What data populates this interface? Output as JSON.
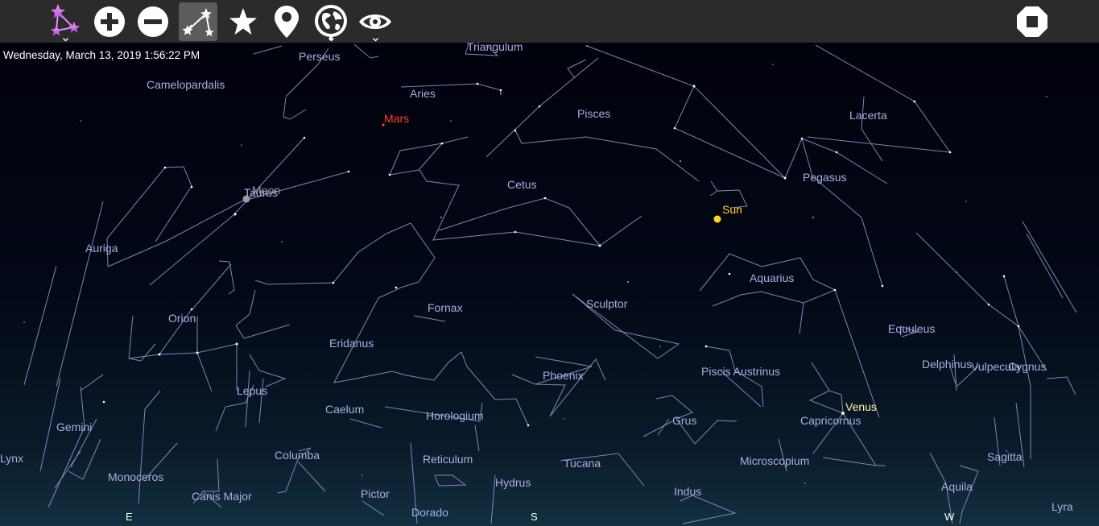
{
  "datetime": "Wednesday, March 13, 2019 1:56:22 PM",
  "toolbar": {
    "tools": [
      {
        "name": "constellations-menu",
        "icon": "constellation-icon",
        "has_dropdown": true
      },
      {
        "name": "zoom-in",
        "icon": "plus-circle-icon"
      },
      {
        "name": "zoom-out",
        "icon": "minus-circle-icon"
      },
      {
        "name": "constellation-lines",
        "icon": "constellation-lines-icon",
        "active": true
      },
      {
        "name": "favorites",
        "icon": "star-icon"
      },
      {
        "name": "location",
        "icon": "map-pin-icon"
      },
      {
        "name": "globe",
        "icon": "globe-icon",
        "has_dropdown": true
      },
      {
        "name": "view",
        "icon": "eye-icon",
        "has_dropdown": true
      },
      {
        "name": "stop",
        "icon": "stop-octagon-icon"
      }
    ]
  },
  "constellations": [
    "Perseus",
    "Triangulum",
    "Camelopardalis",
    "Aries",
    "Mars",
    "Pisces",
    "Lacerta",
    "Cetus",
    "Taurus",
    "Moon",
    "Sun",
    "Pegasus",
    "Auriga",
    "Aquarius",
    "Orion",
    "Fornax",
    "Sculptor",
    "Equuleus",
    "Eridanus",
    "Delphinus",
    "Vulpecula",
    "Cygnus",
    "Phoenix",
    "Piscis Austrinus",
    "Lepus",
    "Venus",
    "Caelum",
    "Horologium",
    "Grus",
    "Capricornus",
    "Gemini",
    "Lynx",
    "Columba",
    "Reticulum",
    "Tucana",
    "Microscopium",
    "Sagitta",
    "Monoceros",
    "Canis Major",
    "Hydrus",
    "Aquila",
    "Pictor",
    "Indus",
    "Dorado",
    "Lyra"
  ],
  "labels": {
    "perseus": "Perseus",
    "triangulum": "Triangulum",
    "camelopardalis": "Camelopardalis",
    "aries": "Aries",
    "pisces": "Pisces",
    "lacerta": "Lacerta",
    "cetus": "Cetus",
    "taurus": "Taurus",
    "pegasus": "Pegasus",
    "auriga": "Auriga",
    "aquarius": "Aquarius",
    "orion": "Orion",
    "fornax": "Fornax",
    "sculptor": "Sculptor",
    "equuleus": "Equuleus",
    "eridanus": "Eridanus",
    "delphinus": "Delphinus",
    "vulpecula": "Vulpecula",
    "cygnus": "Cygnus",
    "phoenix": "Phoenix",
    "piscis_austrinus": "Piscis Austrinus",
    "lepus": "Lepus",
    "caelum": "Caelum",
    "horologium": "Horologium",
    "grus": "Grus",
    "capricornus": "Capricornus",
    "gemini": "Gemini",
    "lynx": "Lynx",
    "columba": "Columba",
    "reticulum": "Reticulum",
    "tucana": "Tucana",
    "microscopium": "Microscopium",
    "sagitta": "Sagitta",
    "monoceros": "Monoceros",
    "canis_major": "Canis Major",
    "hydrus": "Hydrus",
    "aquila": "Aquila",
    "pictor": "Pictor",
    "indus": "Indus",
    "dorado": "Dorado",
    "lyra": "Lyra"
  },
  "planets": {
    "mars": {
      "label": "Mars",
      "color": "#ff3b3b"
    },
    "moon": {
      "label": "Moon",
      "color": "#9b9b9b"
    },
    "sun": {
      "label": "Sun",
      "color": "#ffd21f"
    },
    "venus": {
      "label": "Venus",
      "color": "#fff2a8"
    }
  },
  "compass": {
    "east": "E",
    "south": "S",
    "west": "W"
  },
  "colors": {
    "toolbar_bg": "#2b2b2b",
    "constellation_line": "#8e93c8",
    "constellation_label": "#a8aee3",
    "sky_top": "#00000a",
    "sky_horizon": "#123040"
  }
}
